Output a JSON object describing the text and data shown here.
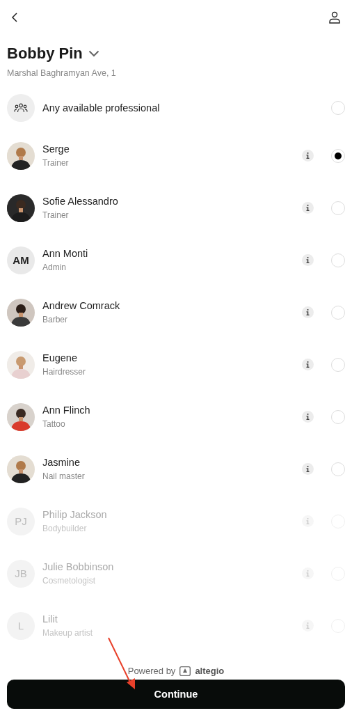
{
  "header": {
    "title": "Bobby Pin",
    "address": "Marshal Baghramyan Ave, 1"
  },
  "options": [
    {
      "kind": "group",
      "name": "Any available professional",
      "selected": false,
      "disabled": false
    },
    {
      "name": "Serge",
      "role": "Trainer",
      "selected": true,
      "disabled": false
    },
    {
      "name": "Sofie Alessandro",
      "role": "Trainer",
      "selected": false,
      "disabled": false
    },
    {
      "kind": "initials",
      "initials": "AM",
      "name": "Ann Monti",
      "role": "Admin",
      "selected": false,
      "disabled": false
    },
    {
      "name": "Andrew Comrack",
      "role": "Barber",
      "selected": false,
      "disabled": false
    },
    {
      "name": "Eugene",
      "role": "Hairdresser",
      "selected": false,
      "disabled": false
    },
    {
      "name": "Ann Flinch",
      "role": "Tattoo",
      "selected": false,
      "disabled": false
    },
    {
      "name": "Jasmine",
      "role": "Nail master",
      "selected": false,
      "disabled": false
    },
    {
      "kind": "initials",
      "initials": "PJ",
      "name": "Philip Jackson",
      "role": "Bodybuilder",
      "selected": false,
      "disabled": true
    },
    {
      "kind": "initials",
      "initials": "JB",
      "name": "Julie Bobbinson",
      "role": "Cosmetologist",
      "selected": false,
      "disabled": true
    },
    {
      "kind": "initials",
      "initials": "L",
      "name": "Lilit",
      "role": "Makeup artist",
      "selected": false,
      "disabled": true
    }
  ],
  "footer": {
    "powered_by": "Powered by",
    "brand": "altegio"
  },
  "button": "Continue"
}
